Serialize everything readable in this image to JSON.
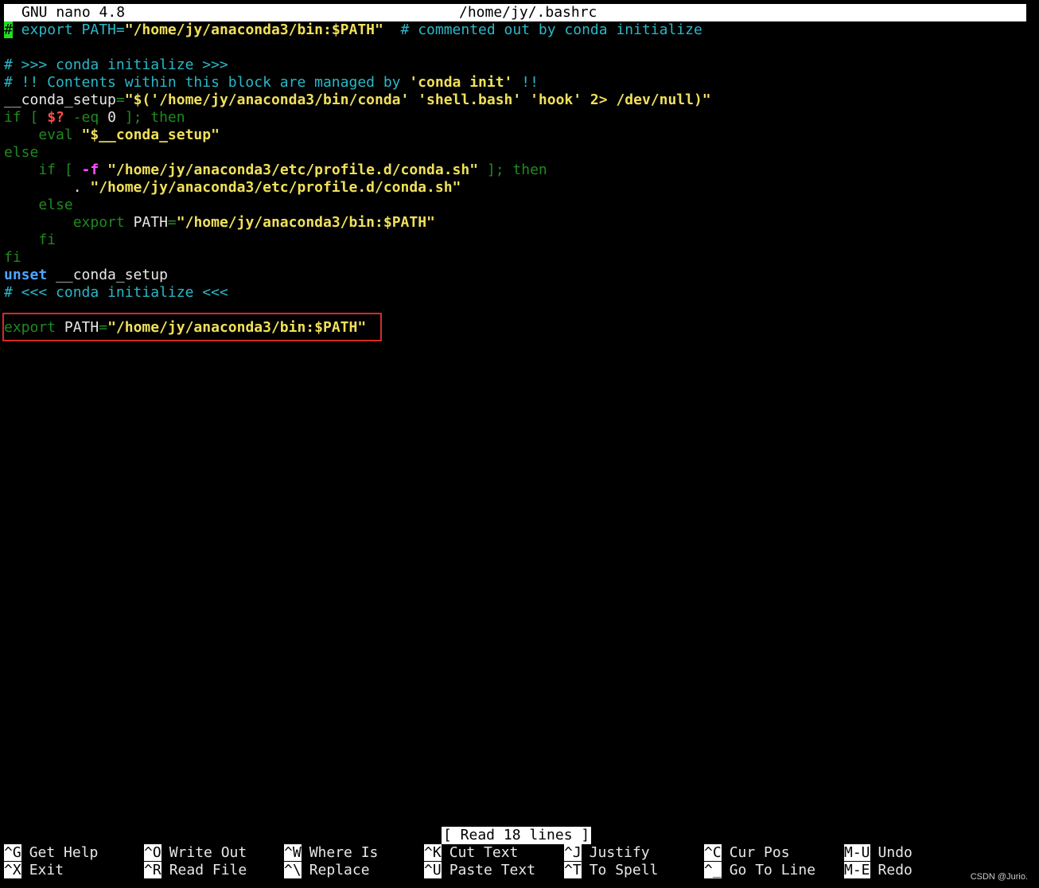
{
  "titlebar": {
    "app": "GNU nano 4.8",
    "file": "/home/jy/.bashrc"
  },
  "editor": {
    "lines": [
      {
        "id": "l1",
        "segments": [
          {
            "cls": "cursor",
            "text": "#"
          },
          {
            "cls": "c-comment",
            "text": " export PATH="
          },
          {
            "cls": "c-str",
            "text": "\"/home/jy/anaconda3/bin:$PATH\""
          },
          {
            "cls": "c-comment",
            "text": "  # commented out by conda initialize"
          }
        ]
      },
      {
        "id": "l2",
        "segments": [
          {
            "cls": "c-white",
            "text": ""
          }
        ]
      },
      {
        "id": "l3",
        "segments": [
          {
            "cls": "c-comment",
            "text": "# >>> conda initialize >>>"
          }
        ]
      },
      {
        "id": "l4",
        "segments": [
          {
            "cls": "c-comment",
            "text": "# !! Contents within this block are managed by "
          },
          {
            "cls": "c-str",
            "text": "'conda init'"
          },
          {
            "cls": "c-comment",
            "text": " !!"
          }
        ]
      },
      {
        "id": "l5",
        "segments": [
          {
            "cls": "c-white",
            "text": "__conda_setup"
          },
          {
            "cls": "c-dim",
            "text": "="
          },
          {
            "cls": "c-str",
            "text": "\"$('/home/jy/anaconda3/bin/conda' 'shell.bash' 'hook' 2> /dev/null)\""
          }
        ]
      },
      {
        "id": "l6",
        "segments": [
          {
            "cls": "c-kw",
            "text": "if [ "
          },
          {
            "cls": "c-var",
            "text": "$?"
          },
          {
            "cls": "c-kw",
            "text": " -eq "
          },
          {
            "cls": "c-white",
            "text": "0"
          },
          {
            "cls": "c-kw",
            "text": " ]; then"
          }
        ]
      },
      {
        "id": "l7",
        "segments": [
          {
            "cls": "c-kw",
            "text": "    eval "
          },
          {
            "cls": "c-str",
            "text": "\"$__conda_setup\""
          }
        ]
      },
      {
        "id": "l8",
        "segments": [
          {
            "cls": "c-kw",
            "text": "else"
          }
        ]
      },
      {
        "id": "l9",
        "segments": [
          {
            "cls": "c-kw",
            "text": "    if [ "
          },
          {
            "cls": "c-opt",
            "text": "-f"
          },
          {
            "cls": "c-white",
            "text": " "
          },
          {
            "cls": "c-str",
            "text": "\"/home/jy/anaconda3/etc/profile.d/conda.sh\""
          },
          {
            "cls": "c-kw",
            "text": " ]; then"
          }
        ]
      },
      {
        "id": "l10",
        "segments": [
          {
            "cls": "c-white",
            "text": "        . "
          },
          {
            "cls": "c-str",
            "text": "\"/home/jy/anaconda3/etc/profile.d/conda.sh\""
          }
        ]
      },
      {
        "id": "l11",
        "segments": [
          {
            "cls": "c-kw",
            "text": "    else"
          }
        ]
      },
      {
        "id": "l12",
        "segments": [
          {
            "cls": "c-kw",
            "text": "        export "
          },
          {
            "cls": "c-white",
            "text": "PATH"
          },
          {
            "cls": "c-dim",
            "text": "="
          },
          {
            "cls": "c-str",
            "text": "\"/home/jy/anaconda3/bin:$PATH\""
          }
        ]
      },
      {
        "id": "l13",
        "segments": [
          {
            "cls": "c-kw",
            "text": "    fi"
          }
        ]
      },
      {
        "id": "l14",
        "segments": [
          {
            "cls": "c-kw",
            "text": "fi"
          }
        ]
      },
      {
        "id": "l15",
        "segments": [
          {
            "cls": "c-builtin",
            "text": "unset"
          },
          {
            "cls": "c-white",
            "text": " __conda_setup"
          }
        ]
      },
      {
        "id": "l16",
        "segments": [
          {
            "cls": "c-comment",
            "text": "# <<< conda initialize <<<"
          }
        ]
      },
      {
        "id": "l17",
        "segments": [
          {
            "cls": "c-white",
            "text": ""
          }
        ]
      },
      {
        "id": "l18",
        "segments": [
          {
            "cls": "c-kw",
            "text": "export "
          },
          {
            "cls": "c-white",
            "text": "PATH"
          },
          {
            "cls": "c-dim",
            "text": "="
          },
          {
            "cls": "c-str",
            "text": "\"/home/jy/anaconda3/bin:$PATH\""
          }
        ]
      }
    ]
  },
  "status": {
    "message": "[ Read 18 lines ]"
  },
  "shortcuts": [
    {
      "key": "^G",
      "label": "Get Help"
    },
    {
      "key": "^X",
      "label": "Exit"
    },
    {
      "key": "^O",
      "label": "Write Out"
    },
    {
      "key": "^R",
      "label": "Read File"
    },
    {
      "key": "^W",
      "label": "Where Is"
    },
    {
      "key": "^\\",
      "label": "Replace"
    },
    {
      "key": "^K",
      "label": "Cut Text"
    },
    {
      "key": "^U",
      "label": "Paste Text"
    },
    {
      "key": "^J",
      "label": "Justify"
    },
    {
      "key": "^T",
      "label": "To Spell"
    },
    {
      "key": "^C",
      "label": "Cur Pos"
    },
    {
      "key": "^_",
      "label": "Go To Line"
    },
    {
      "key": "M-U",
      "label": "Undo"
    },
    {
      "key": "M-E",
      "label": "Redo"
    }
  ],
  "watermark": "CSDN @Jurio."
}
